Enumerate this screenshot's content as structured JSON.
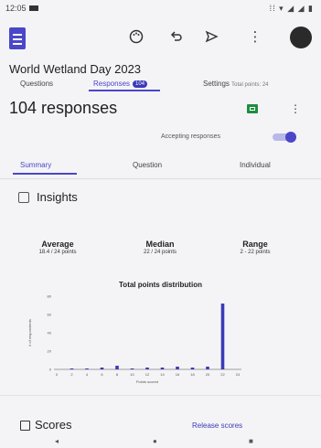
{
  "status": {
    "time": "12:05",
    "right_icons": "⁞⁞ ▾ ◢ ◢ ▮"
  },
  "toolbar": {
    "palette_icon": "palette-icon",
    "undo_icon": "undo-icon",
    "send_icon": "send-icon",
    "more_icon": "more-icon"
  },
  "form_title": "World Wetland Day 2023",
  "tabs": [
    {
      "label": "Questions"
    },
    {
      "label": "Responses",
      "badge": "104"
    },
    {
      "label": "Settings",
      "extra": "Total points: 24"
    }
  ],
  "responses_count": "104 responses",
  "accepting_label": "Accepting responses",
  "subtabs": [
    "Summary",
    "Question",
    "Individual"
  ],
  "insights": {
    "title": "Insights",
    "stats": [
      {
        "label": "Average",
        "value": "18.4 / 24 points"
      },
      {
        "label": "Median",
        "value": "22 / 24 points"
      },
      {
        "label": "Range",
        "value": "2 - 22 points"
      }
    ]
  },
  "chart_data": {
    "type": "bar",
    "title": "Total points distribution",
    "xlabel": "Points scored",
    "ylabel": "# of respondents",
    "categories": [
      "0",
      "2",
      "4",
      "6",
      "8",
      "10",
      "12",
      "14",
      "16",
      "18",
      "20",
      "22",
      "24"
    ],
    "values": [
      0,
      1,
      1,
      2,
      4,
      1,
      2,
      2,
      3,
      2,
      3,
      72,
      0
    ],
    "yticks": [
      "0",
      "20",
      "40",
      "60",
      "80"
    ],
    "ylim": [
      0,
      80
    ],
    "color": "#3b3ab8"
  },
  "scores": {
    "title": "Scores",
    "release_label": "Release scores"
  },
  "navbar": {
    "back": "◂",
    "home": "●",
    "recents": "■"
  }
}
